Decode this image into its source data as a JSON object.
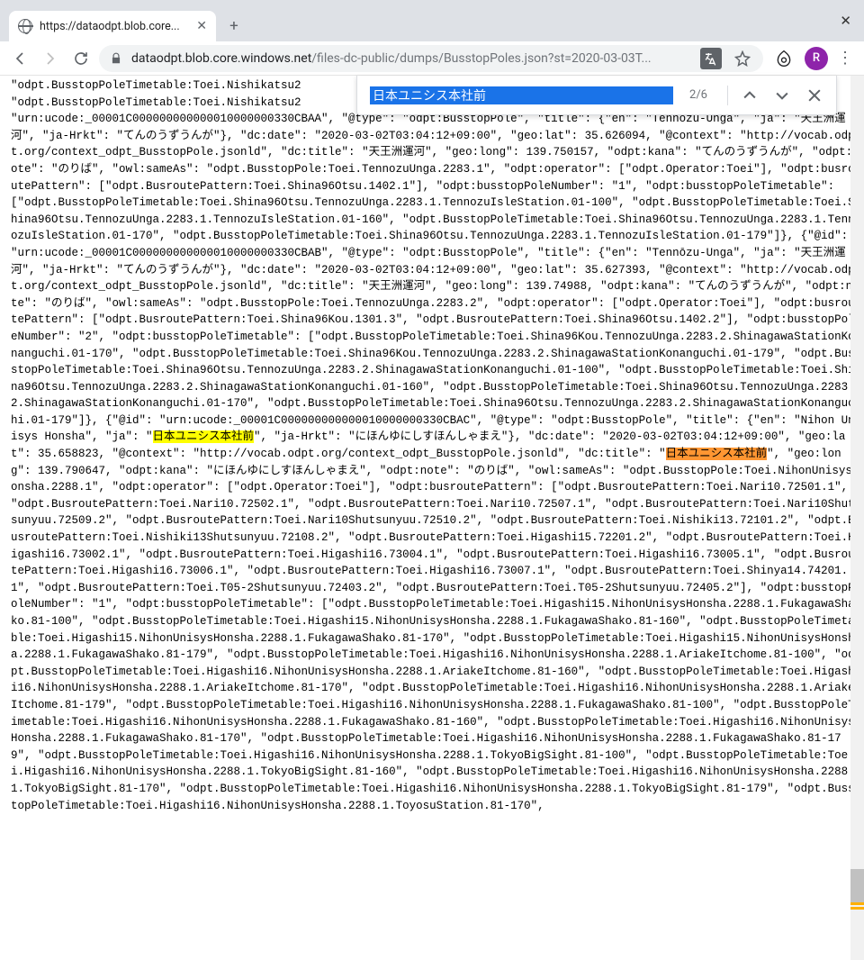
{
  "browser": {
    "tab_title": "https://dataodpt.blob.core...",
    "url_host": "dataodpt.blob.core.windows.net",
    "url_path": "/files-dc-public/dumps/BusstopPoles.json?st=2020-03-03T...",
    "avatar_initial": "R"
  },
  "find": {
    "query": "日本ユニシス本社前",
    "count": "2/6",
    "match_text": "日本ユニシス本社前"
  },
  "content": {
    "lines": [
      "\"odpt.BusstopPoleTimetable:Toei.Nishikatsu2",
      "\"odpt.BusstopPoleTimetable:Toei.Nishikatsu2",
      "\"urn:ucode:_00001C000000000000010000000330CBAA\", \"@type\": \"odpt:BusstopPole\", \"title\": {\"en\": \"Tennōzu-Unga\", \"ja\": \"天王洲運河\", \"ja-Hrkt\": \"てんのうずうんが\"}, \"dc:date\": \"2020-03-02T03:04:12+09:00\", \"geo:lat\": 35.626094, \"@context\": \"http://vocab.odpt.org/context_odpt_BusstopPole.jsonld\", \"dc:title\": \"天王洲運河\", \"geo:long\": 139.750157, \"odpt:kana\": \"てんのうずうんが\", \"odpt:note\": \"のりば\", \"owl:sameAs\": \"odpt.BusstopPole:Toei.TennozuUnga.2283.1\", \"odpt:operator\": [\"odpt.Operator:Toei\"], \"odpt:busroutePattern\": [\"odpt.BusroutePattern:Toei.Shina96Otsu.1402.1\"], \"odpt:busstopPoleNumber\": \"1\", \"odpt:busstopPoleTimetable\": [\"odpt.BusstopPoleTimetable:Toei.Shina96Otsu.TennozuUnga.2283.1.TennozuIsleStation.01-100\", \"odpt.BusstopPoleTimetable:Toei.Shina96Otsu.TennozuUnga.2283.1.TennozuIsleStation.01-160\", \"odpt.BusstopPoleTimetable:Toei.Shina96Otsu.TennozuUnga.2283.1.TennozuIsleStation.01-170\", \"odpt.BusstopPoleTimetable:Toei.Shina96Otsu.TennozuUnga.2283.1.TennozuIsleStation.01-179\"]}, {\"@id\": \"urn:ucode:_00001C000000000000010000000330CBAB\", \"@type\": \"odpt:BusstopPole\", \"title\": {\"en\": \"Tennōzu-Unga\", \"ja\": \"天王洲運河\", \"ja-Hrkt\": \"てんのうずうんが\"}, \"dc:date\": \"2020-03-02T03:04:12+09:00\", \"geo:lat\": 35.627393, \"@context\": \"http://vocab.odpt.org/context_odpt_BusstopPole.jsonld\", \"dc:title\": \"天王洲運河\", \"geo:long\": 139.74988, \"odpt:kana\": \"てんのうずうんが\", \"odpt:note\": \"のりば\", \"owl:sameAs\": \"odpt.BusstopPole:Toei.TennozuUnga.2283.2\", \"odpt:operator\": [\"odpt.Operator:Toei\"], \"odpt:busroutePattern\": [\"odpt.BusroutePattern:Toei.Shina96Kou.1301.3\", \"odpt.BusroutePattern:Toei.Shina96Otsu.1402.2\"], \"odpt:busstopPoleNumber\": \"2\", \"odpt:busstopPoleTimetable\": [\"odpt.BusstopPoleTimetable:Toei.Shina96Kou.TennozuUnga.2283.2.ShinagawaStationKonanguchi.01-170\", \"odpt.BusstopPoleTimetable:Toei.Shina96Kou.TennozuUnga.2283.2.ShinagawaStationKonanguchi.01-179\", \"odpt.BusstopPoleTimetable:Toei.Shina96Otsu.TennozuUnga.2283.2.ShinagawaStationKonanguchi.01-100\", \"odpt.BusstopPoleTimetable:Toei.Shina96Otsu.TennozuUnga.2283.2.ShinagawaStationKonanguchi.01-160\", \"odpt.BusstopPoleTimetable:Toei.Shina96Otsu.TennozuUnga.2283.2.ShinagawaStationKonanguchi.01-170\", \"odpt.BusstopPoleTimetable:Toei.Shina96Otsu.TennozuUnga.2283.2.ShinagawaStationKonanguchi.01-179\"]}, {\"@id\": \"urn:ucode:_00001C000000000000010000000330CBAC\", \"@type\": \"odpt:BusstopPole\", \"title\": {\"en\": \"Nihon Unisys Honsha\", \"ja\": \"",
      "\", \"ja-Hrkt\": \"にほんゆにしすほんしゃまえ\"}, \"dc:date\": \"2020-03-02T03:04:12+09:00\", \"geo:lat\": 35.658823, \"@context\": \"http://vocab.odpt.org/context_odpt_BusstopPole.jsonld\", \"dc:title\": \"",
      "\", \"geo:long\": 139.790647, \"odpt:kana\": \"にほんゆにしすほんしゃまえ\", \"odpt:note\": \"のりば\", \"owl:sameAs\": \"odpt.BusstopPole:Toei.NihonUnisysHonsha.2288.1\", \"odpt:operator\": [\"odpt.Operator:Toei\"], \"odpt:busroutePattern\": [\"odpt.BusroutePattern:Toei.Nari10.72501.1\", \"odpt.BusroutePattern:Toei.Nari10.72502.1\", \"odpt.BusroutePattern:Toei.Nari10.72507.1\", \"odpt.BusroutePattern:Toei.Nari10Shutsunyuu.72509.2\", \"odpt.BusroutePattern:Toei.Nari10Shutsunyuu.72510.2\", \"odpt.BusroutePattern:Toei.Nishiki13.72101.2\", \"odpt.BusroutePattern:Toei.Nishiki13Shutsunyuu.72108.2\", \"odpt.BusroutePattern:Toei.Higashi15.72201.2\", \"odpt.BusroutePattern:Toei.Higashi16.73002.1\", \"odpt.BusroutePattern:Toei.Higashi16.73004.1\", \"odpt.BusroutePattern:Toei.Higashi16.73005.1\", \"odpt.BusroutePattern:Toei.Higashi16.73006.1\", \"odpt.BusroutePattern:Toei.Higashi16.73007.1\", \"odpt.BusroutePattern:Toei.Shinya14.74201.1\", \"odpt.BusroutePattern:Toei.T05-2Shutsunyuu.72403.2\", \"odpt.BusroutePattern:Toei.T05-2Shutsunyuu.72405.2\"], \"odpt:busstopPoleNumber\": \"1\", \"odpt:busstopPoleTimetable\": [\"odpt.BusstopPoleTimetable:Toei.Higashi15.NihonUnisysHonsha.2288.1.FukagawaShako.81-100\", \"odpt.BusstopPoleTimetable:Toei.Higashi15.NihonUnisysHonsha.2288.1.FukagawaShako.81-160\", \"odpt.BusstopPoleTimetable:Toei.Higashi15.NihonUnisysHonsha.2288.1.FukagawaShako.81-170\", \"odpt.BusstopPoleTimetable:Toei.Higashi15.NihonUnisysHonsha.2288.1.FukagawaShako.81-179\", \"odpt.BusstopPoleTimetable:Toei.Higashi16.NihonUnisysHonsha.2288.1.AriakeItchome.81-100\", \"odpt.BusstopPoleTimetable:Toei.Higashi16.NihonUnisysHonsha.2288.1.AriakeItchome.81-160\", \"odpt.BusstopPoleTimetable:Toei.Higashi16.NihonUnisysHonsha.2288.1.AriakeItchome.81-170\", \"odpt.BusstopPoleTimetable:Toei.Higashi16.NihonUnisysHonsha.2288.1.AriakeItchome.81-179\", \"odpt.BusstopPoleTimetable:Toei.Higashi16.NihonUnisysHonsha.2288.1.FukagawaShako.81-100\", \"odpt.BusstopPoleTimetable:Toei.Higashi16.NihonUnisysHonsha.2288.1.FukagawaShako.81-160\", \"odpt.BusstopPoleTimetable:Toei.Higashi16.NihonUnisysHonsha.2288.1.FukagawaShako.81-170\", \"odpt.BusstopPoleTimetable:Toei.Higashi16.NihonUnisysHonsha.2288.1.FukagawaShako.81-179\", \"odpt.BusstopPoleTimetable:Toei.Higashi16.NihonUnisysHonsha.2288.1.TokyoBigSight.81-100\", \"odpt.BusstopPoleTimetable:Toei.Higashi16.NihonUnisysHonsha.2288.1.TokyoBigSight.81-160\", \"odpt.BusstopPoleTimetable:Toei.Higashi16.NihonUnisysHonsha.2288.1.TokyoBigSight.81-170\", \"odpt.BusstopPoleTimetable:Toei.Higashi16.NihonUnisysHonsha.2288.1.TokyoBigSight.81-179\", \"odpt.BusstopPoleTimetable:Toei.Higashi16.NihonUnisysHonsha.2288.1.ToyosuStation.81-170\","
    ]
  }
}
